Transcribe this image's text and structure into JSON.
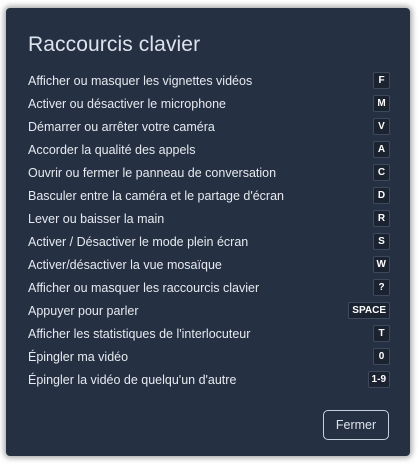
{
  "dialog": {
    "title": "Raccourcis clavier",
    "shortcuts": [
      {
        "label": "Afficher ou masquer les vignettes vidéos",
        "key": "F"
      },
      {
        "label": "Activer ou désactiver le microphone",
        "key": "M"
      },
      {
        "label": "Démarrer ou arrêter votre caméra",
        "key": "V"
      },
      {
        "label": "Accorder la qualité des appels",
        "key": "A"
      },
      {
        "label": "Ouvrir ou fermer le panneau de conversation",
        "key": "C"
      },
      {
        "label": "Basculer entre la caméra et le partage d'écran",
        "key": "D"
      },
      {
        "label": "Lever ou baisser la main",
        "key": "R"
      },
      {
        "label": "Activer / Désactiver le mode plein écran",
        "key": "S"
      },
      {
        "label": "Activer/désactiver la vue mosaïque",
        "key": "W"
      },
      {
        "label": "Afficher ou masquer les raccourcis clavier",
        "key": "?"
      },
      {
        "label": "Appuyer pour parler",
        "key": "SPACE"
      },
      {
        "label": "Afficher les statistiques de l'interlocuteur",
        "key": "T"
      },
      {
        "label": "Épingler ma vidéo",
        "key": "0"
      },
      {
        "label": "Épingler la vidéo de quelqu'un d'autre",
        "key": "1-9"
      }
    ],
    "close_label": "Fermer"
  },
  "colors": {
    "dialog_background": "#253042",
    "key_background": "#1b2330",
    "text": "#e6eaf0"
  }
}
